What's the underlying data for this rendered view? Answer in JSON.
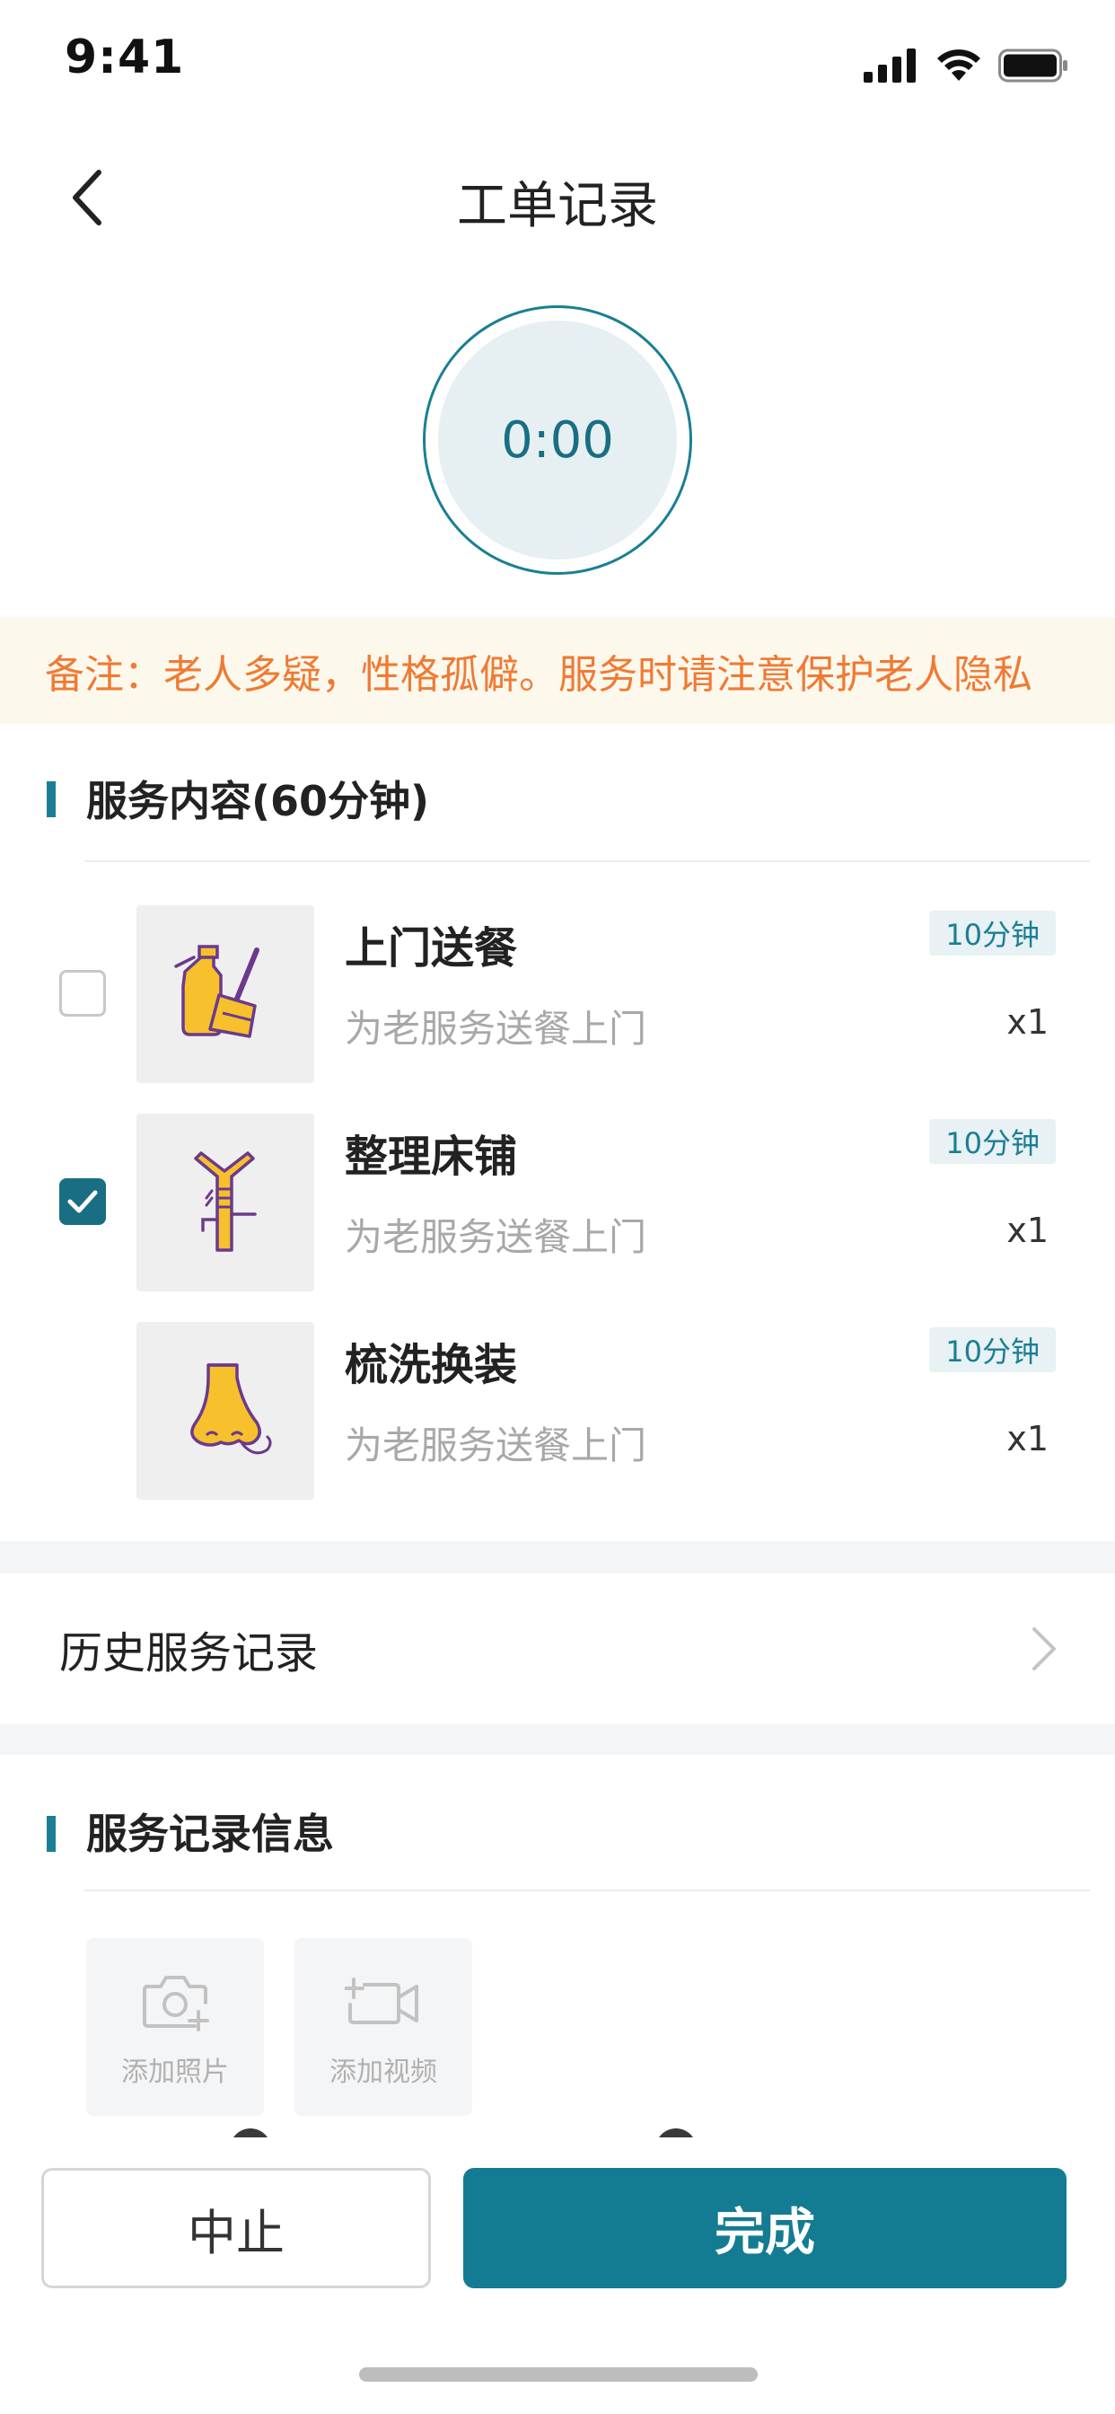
{
  "status_bar": {
    "time": "9:41"
  },
  "nav": {
    "title": "工单记录",
    "back_icon": "chevron-left-icon"
  },
  "timer": {
    "value": "0:00"
  },
  "remark": {
    "text": "备注：老人多疑，性格孤僻。服务时请注意保护老人隐私"
  },
  "service_section": {
    "title": "服务内容(60分钟)",
    "items": [
      {
        "name": "上门送餐",
        "desc": "为老服务送餐上门",
        "duration": "10分钟",
        "qty": "x1",
        "checked": false,
        "icon": "cleaning-spray-broom-icon"
      },
      {
        "name": "整理床铺",
        "desc": "为老服务送餐上门",
        "duration": "10分钟",
        "qty": "x1",
        "checked": true,
        "icon": "trachea-icon"
      },
      {
        "name": "梳洗换装",
        "desc": "为老服务送餐上门",
        "duration": "10分钟",
        "qty": "x1",
        "checked": null,
        "icon": "nose-icon"
      }
    ]
  },
  "history": {
    "label": "历史服务记录"
  },
  "record_section": {
    "title": "服务记录信息",
    "add_photo_label": "添加照片",
    "add_video_label": "添加视频"
  },
  "actions": {
    "stop_label": "中止",
    "finish_label": "完成"
  },
  "colors": {
    "primary": "#137c92",
    "remark_text": "#f07a34",
    "remark_bg": "#fdf8ec",
    "icon_yellow": "#f7c02d",
    "icon_purple": "#6b3a8c"
  }
}
